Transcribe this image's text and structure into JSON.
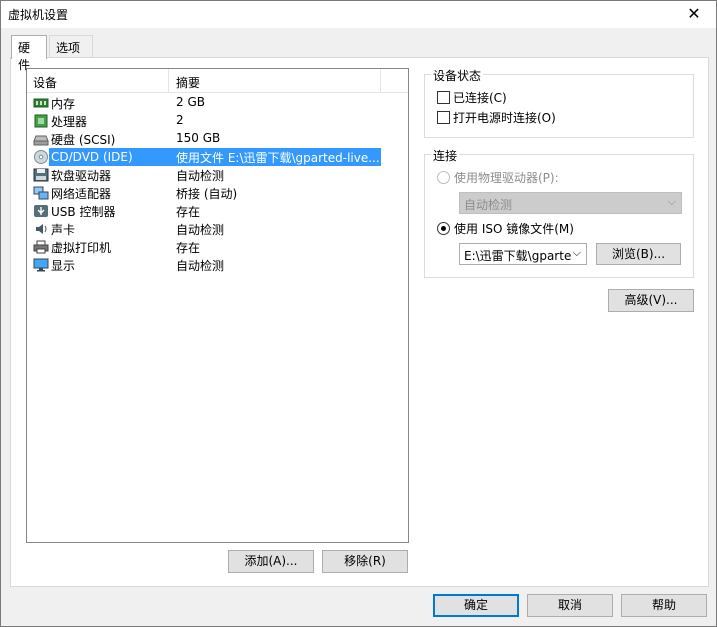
{
  "window": {
    "title": "虚拟机设置",
    "close_glyph": "✕"
  },
  "tabs": [
    {
      "label": "硬件"
    },
    {
      "label": "选项"
    }
  ],
  "device_list": {
    "columns": {
      "device": "设备",
      "summary": "摘要"
    },
    "rows": [
      {
        "device": "内存",
        "summary": "2 GB",
        "icon": "memory-icon"
      },
      {
        "device": "处理器",
        "summary": "2",
        "icon": "processor-icon"
      },
      {
        "device": "硬盘 (SCSI)",
        "summary": "150 GB",
        "icon": "hard-disk-icon"
      },
      {
        "device": "CD/DVD (IDE)",
        "summary": "使用文件 E:\\迅雷下载\\gparted-live...",
        "icon": "cd-dvd-icon",
        "selected": true
      },
      {
        "device": "软盘驱动器",
        "summary": "自动检测",
        "icon": "floppy-icon"
      },
      {
        "device": "网络适配器",
        "summary": "桥接 (自动)",
        "icon": "network-adapter-icon"
      },
      {
        "device": "USB 控制器",
        "summary": "存在",
        "icon": "usb-icon"
      },
      {
        "device": "声卡",
        "summary": "自动检测",
        "icon": "sound-card-icon"
      },
      {
        "device": "虚拟打印机",
        "summary": "存在",
        "icon": "printer-icon"
      },
      {
        "device": "显示",
        "summary": "自动检测",
        "icon": "display-icon"
      }
    ]
  },
  "list_buttons": {
    "add": "添加(A)...",
    "remove": "移除(R)"
  },
  "device_status": {
    "legend": "设备状态",
    "connected": {
      "label": "已连接(C)",
      "checked": false
    },
    "connect_at_power_on": {
      "label": "打开电源时连接(O)",
      "checked": false
    }
  },
  "connection": {
    "legend": "连接",
    "physical_drive": {
      "label": "使用物理驱动器(P):",
      "selected": false,
      "disabled": true
    },
    "physical_drive_select": {
      "value": "自动检测"
    },
    "iso_image": {
      "label": "使用 ISO 镜像文件(M)",
      "selected": true
    },
    "iso_path": {
      "value": "E:\\迅雷下载\\gparte"
    },
    "browse_button": "浏览(B)..."
  },
  "advanced_button": "高级(V)...",
  "footer": {
    "ok": "确定",
    "cancel": "取消",
    "help": "帮助"
  },
  "colors": {
    "selection": "#3399ff",
    "default_button_border": "#0078d7"
  }
}
